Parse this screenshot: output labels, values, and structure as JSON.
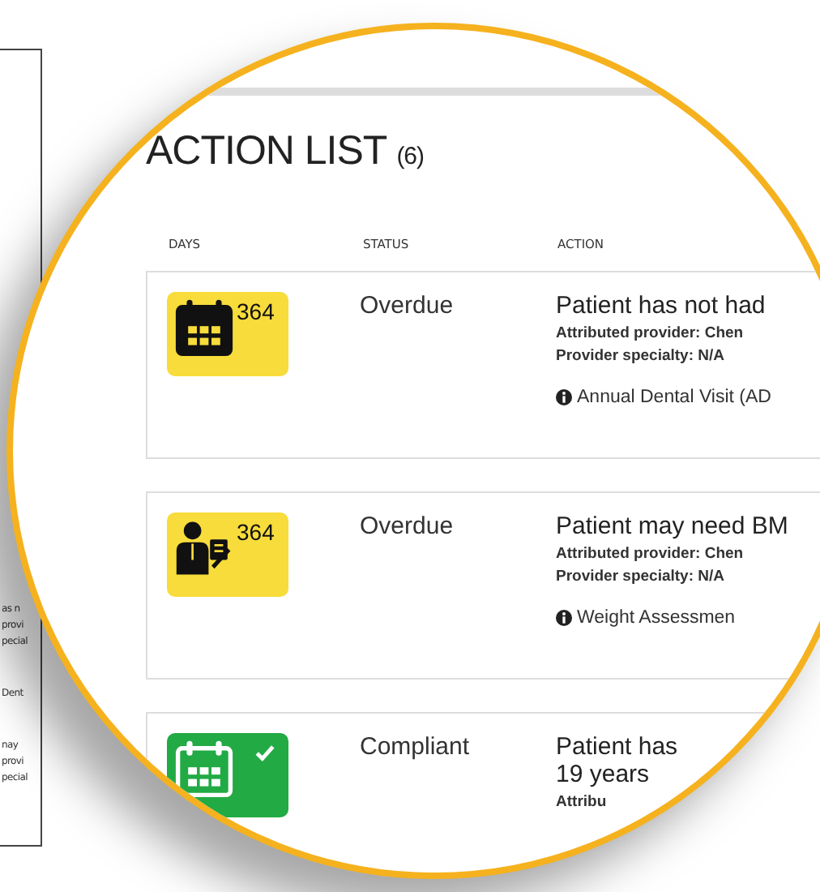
{
  "background_page": {
    "lines": [
      "as n",
      "provi",
      "pecial",
      "Dent",
      "nay",
      "provi",
      "pecial"
    ]
  },
  "title": "ACTION LIST",
  "count": "(6)",
  "columns": [
    "DAYS",
    "STATUS",
    "ACTION"
  ],
  "rows": [
    {
      "kind": "calendar",
      "color": "#f7dc3b",
      "days": "364",
      "checked": false,
      "status": "Overdue",
      "action": "Patient has not had",
      "details": [
        "Attributed provider: Chen",
        "Provider specialty: N/A"
      ],
      "measure": "Annual Dental Visit (AD"
    },
    {
      "kind": "clinician",
      "color": "#f7dc3b",
      "days": "364",
      "checked": false,
      "status": "Overdue",
      "action": "Patient may need BM",
      "details": [
        "Attributed provider: Chen",
        "Provider specialty: N/A"
      ],
      "measure": "Weight Assessmen"
    },
    {
      "kind": "calendar",
      "color": "#22aa44",
      "checked": true,
      "status": "Compliant",
      "action": "Patient has",
      "action_line_2": "19 years",
      "details": [
        "Attribu"
      ]
    }
  ]
}
